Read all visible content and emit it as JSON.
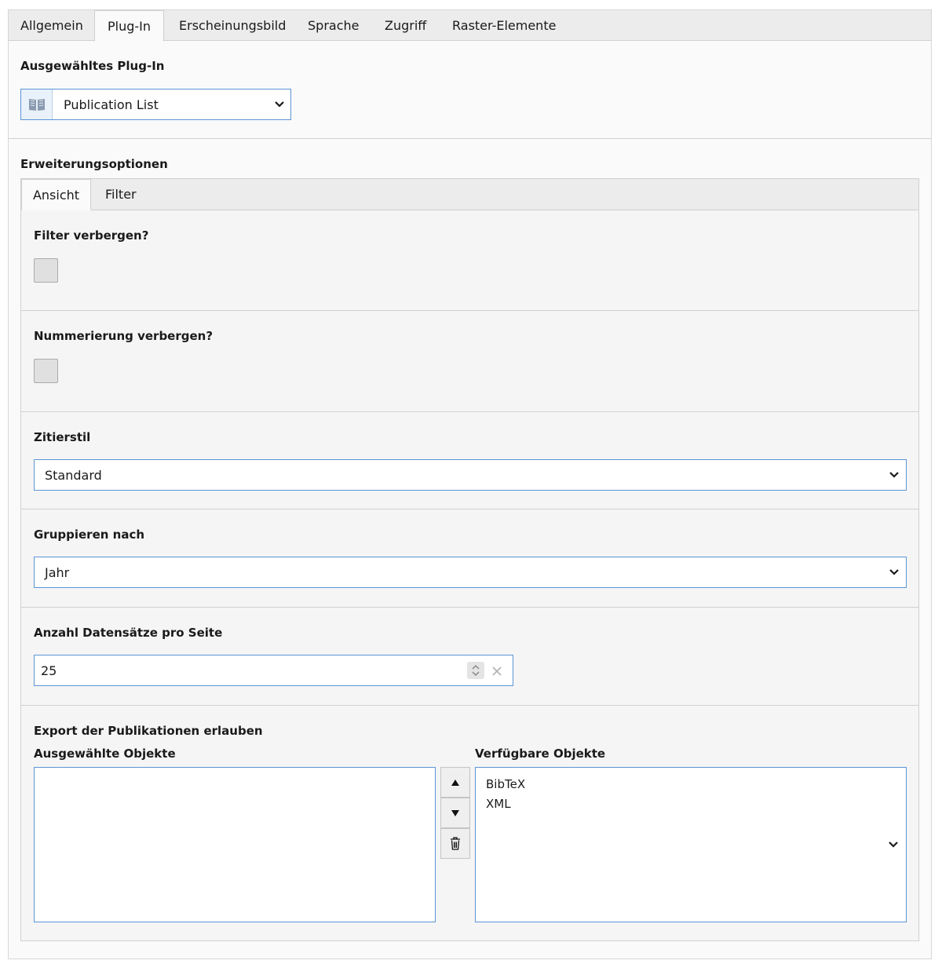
{
  "top_tabs": [
    "Allgemein",
    "Plug-In",
    "Erscheinungsbild",
    "Sprache",
    "Zugriff",
    "Raster-Elemente"
  ],
  "plugin": {
    "label": "Ausgewähltes Plug-In",
    "value": "Publication List",
    "icon": "book-icon"
  },
  "extension": {
    "label": "Erweiterungsoptionen",
    "tabs": [
      "Ansicht",
      "Filter"
    ]
  },
  "fields": {
    "hide_filter": {
      "label": "Filter verbergen?",
      "checked": false
    },
    "hide_numbering": {
      "label": "Nummerierung verbergen?",
      "checked": false
    },
    "citation_style": {
      "label": "Zitierstil",
      "value": "Standard"
    },
    "group_by": {
      "label": "Gruppieren nach",
      "value": "Jahr"
    },
    "per_page": {
      "label": "Anzahl Datensätze pro Seite",
      "value": "25"
    },
    "export": {
      "label": "Export der Publikationen erlauben",
      "selected_label": "Ausgewählte Objekte",
      "available_label": "Verfügbare Objekte",
      "available_items": [
        "BibTeX",
        "XML"
      ]
    }
  },
  "colors": {
    "focus_border": "#5b95d6",
    "panel_bg": "#f5f5f5",
    "tab_bar_bg": "#ececec"
  }
}
